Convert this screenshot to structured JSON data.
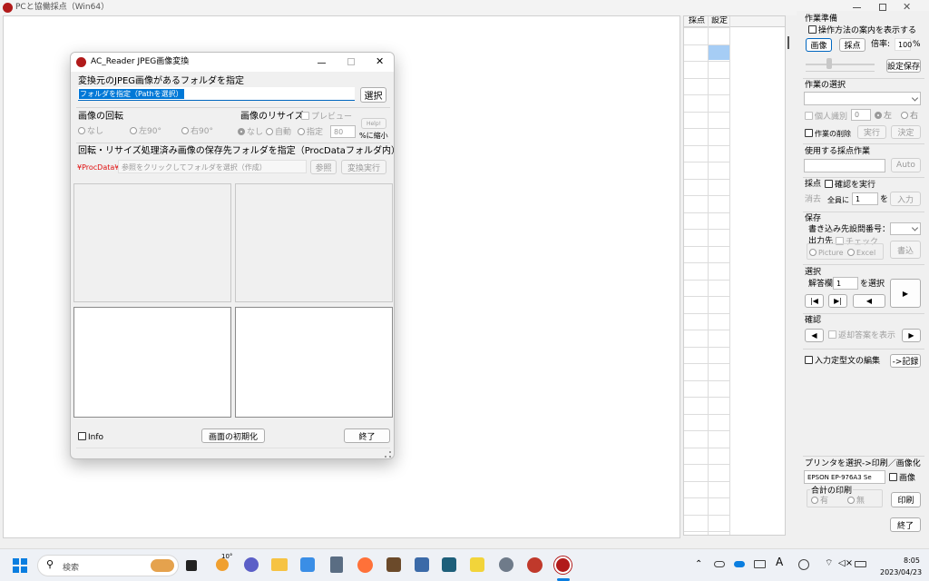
{
  "main_window": {
    "title": "PCと協働採点（Win64）"
  },
  "grid": {
    "headers": [
      "採点",
      "設定"
    ]
  },
  "right_panel": {
    "prep": {
      "title": "作業準備",
      "show_guide": "操作方法の案内を表示する",
      "image_btn": "画像",
      "grade_btn": "採点",
      "zoom_label": "倍率:",
      "zoom_value": "100",
      "zoom_unit": "%",
      "save_settings": "設定保存"
    },
    "select_work": {
      "title": "作業の選択",
      "individual": "個人識別",
      "num": "0",
      "left": "左",
      "right": "右",
      "delete_work": "作業の削除",
      "run": "実行",
      "decide": "決定"
    },
    "used_work": {
      "title": "使用する採点作業",
      "auto": "Auto"
    },
    "grading": {
      "title": "採点",
      "confirm_run": "確認を実行",
      "erase": "消去",
      "all_to": "全員に",
      "num": "1",
      "wo": "を",
      "input": "入力"
    },
    "save": {
      "title": "保存",
      "write_target": "書き込み先設問番号：",
      "output_to": "出力先",
      "check": "チェック",
      "picture": "Picture",
      "excel": "Excel",
      "write": "書込"
    },
    "select": {
      "title": "選択",
      "answer_col": "解答欄",
      "num": "1",
      "select_label": "を選択"
    },
    "confirm": {
      "title": "確認",
      "show_returned": "返却答案を表示"
    },
    "edit_template": "入力定型文の編集",
    "record": "->記録",
    "print": {
      "title": "プリンタを選択->印刷／画像化",
      "printer": "EPSON EP-976A3 Se",
      "image": "画像",
      "total_title": "合計の印刷",
      "yes": "有",
      "no": "無",
      "print_btn": "印刷"
    },
    "exit": "終了"
  },
  "dialog": {
    "title": "AC_Reader JPEG画像変換",
    "src_label": "変換元のJPEG画像があるフォルダを指定",
    "src_input": "フォルダを指定（Pathを選択）",
    "select_btn": "選択",
    "rotate": {
      "title": "画像の回転",
      "none": "なし",
      "left90": "左90°",
      "right90": "右90°"
    },
    "resize": {
      "title": "画像のリサイズ",
      "preview": "プレビュー",
      "none": "なし",
      "auto": "自動",
      "manual": "指定",
      "value": "80",
      "help": "Help!",
      "shrink": "%に縮小"
    },
    "dest_label": "回転・リサイズ処理済み画像の保存先フォルダを指定（ProcDataフォルダ内）",
    "dest_prefix": "¥ProcData¥",
    "dest_placeholder": "参照をクリックしてフォルダを選択（作成）",
    "browse_btn": "参照",
    "convert_btn": "変換実行",
    "info": "Info",
    "reset_btn": "画面の初期化",
    "end_btn": "終了"
  },
  "taskbar": {
    "search": "検索",
    "weather": "10°",
    "time": "8:05",
    "date": "2023/04/23"
  }
}
